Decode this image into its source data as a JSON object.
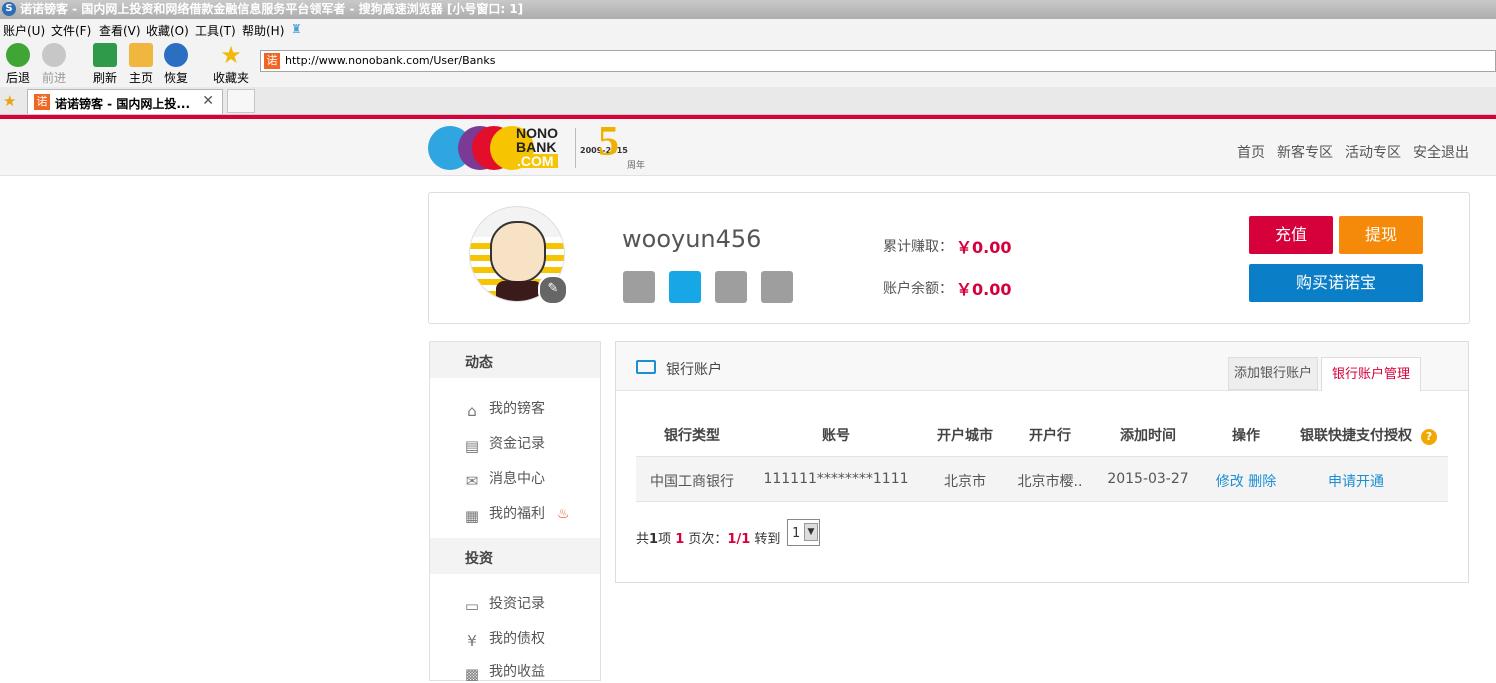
{
  "browser": {
    "window_title": "诺诺镑客 - 国内网上投资和网络借款金融信息服务平台领军者 - 搜狗高速浏览器 [小号窗口: 1]",
    "menu": [
      "账户(U)",
      "文件(F)",
      "查看(V)",
      "收藏(O)",
      "工具(T)",
      "帮助(H)"
    ],
    "toolbar": {
      "back": "后退",
      "forward": "前进",
      "refresh": "刷新",
      "home": "主页",
      "restore": "恢复",
      "favorites": "收藏夹"
    },
    "address": "http://www.nonobank.com/User/Banks",
    "favicon_char": "诺",
    "tab_title": "诺诺镑客 - 国内网上投...",
    "tab_close": "✕"
  },
  "site": {
    "logo_text": [
      "NONO",
      "BANK",
      ".COM"
    ],
    "anniversary": {
      "years": "2009-2015",
      "number": "5",
      "suffix": "周年"
    },
    "nav": [
      "首页",
      "新客专区",
      "活动专区",
      "安全退出"
    ]
  },
  "profile": {
    "username": "wooyun456",
    "earned_label": "累计赚取：",
    "earned_value": "￥0.00",
    "balance_label": "账户余额：",
    "balance_value": "￥0.00",
    "buttons": {
      "recharge": "充值",
      "withdraw": "提现",
      "buy": "购买诺诺宝"
    },
    "verify_icons": [
      "id-card-icon",
      "phone-icon",
      "bank-card-icon",
      "key-icon"
    ]
  },
  "sidebar": {
    "sections": [
      {
        "title": "动态",
        "items": [
          "我的镑客",
          "资金记录",
          "消息中心",
          "我的福利"
        ]
      },
      {
        "title": "投资",
        "items": [
          "投资记录",
          "我的债权",
          "我的收益"
        ]
      }
    ]
  },
  "panel": {
    "title": "银行账户",
    "tabs": [
      "添加银行账户",
      "银行账户管理"
    ],
    "active_tab": 1,
    "columns": [
      "银行类型",
      "账号",
      "开户城市",
      "开户行",
      "添加时间",
      "操作",
      "银联快捷支付授权"
    ],
    "rows": [
      {
        "bank": "中国工商银行",
        "account": "111111********1111",
        "city": "北京市",
        "branch": "北京市樱..",
        "date": "2015-03-27",
        "ops": [
          "修改",
          "删除"
        ],
        "auth": "申请开通"
      }
    ],
    "pager": {
      "prefix": "共",
      "count": "1",
      "items_word": "项",
      "page": "1",
      "pages_label": "页次：",
      "page_of": "1/1",
      "goto": "转到",
      "select": "1"
    }
  },
  "colors": {
    "brand_red": "#d6003b",
    "orange": "#f5890a",
    "blue": "#0a7fc8",
    "link": "#1a8fd6"
  }
}
